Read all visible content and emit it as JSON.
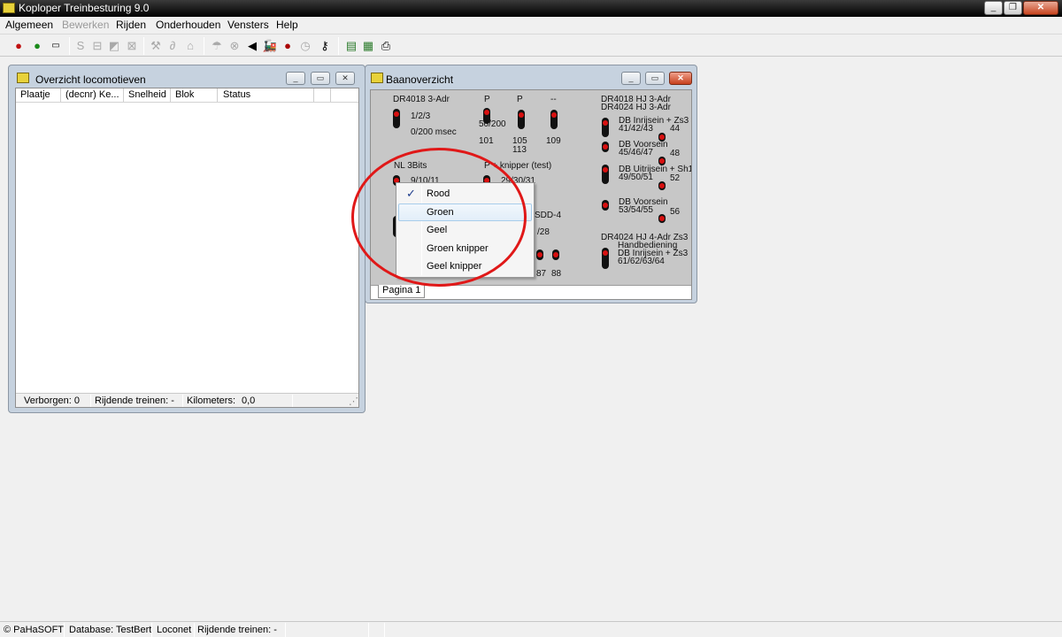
{
  "app": {
    "title": "Koploper Treinbesturing 9.0"
  },
  "menu": [
    "Algemeen",
    "Bewerken",
    "Rijden",
    "Onderhouden",
    "Vensters",
    "Help"
  ],
  "toolbar_icons": [
    "signal-red-icon",
    "signal-green-icon",
    "keyboard-icon",
    "s-icon",
    "block-icon",
    "route-icon",
    "delete-icon",
    "switch-icon",
    "lamp-icon",
    "horn-icon",
    "sound-icon",
    "locomotive-icon",
    "red-dot-icon",
    "clock-icon",
    "key-icon",
    "document-icon",
    "page-copy-icon",
    "printer-icon"
  ],
  "loco_window": {
    "title": "Overzicht locomotieven",
    "columns": [
      "Plaatje",
      "(decnr) Ke...",
      "Snelheid",
      "Blok",
      "Status"
    ],
    "status": {
      "hidden": "Verborgen: 0",
      "driving": "Rijdende treinen: -",
      "km_label": "Kilometers:",
      "km_value": "0,0"
    }
  },
  "track_window": {
    "title": "Baanoverzicht",
    "tab": "Pagina 1",
    "labels": {
      "dr4018": "DR4018 3-Adr",
      "addr123": "1/2/3",
      "msec": "0/200 msec",
      "p1": "P",
      "p1val": "50/200",
      "n101": "101",
      "p2": "P",
      "n105": "105",
      "n113": "113",
      "dash": "--",
      "n109": "109",
      "nl3bits": "NL 3Bits",
      "knipper": "P + knipper (test)",
      "addr9": "9/10/11",
      "addr29": "29/30/31",
      "sdd4": "SDD-4",
      "addr28": "/28",
      "n87": "87",
      "n88": "88",
      "hj3a": "DR4018 HJ 3-Adr",
      "hj3b": "DR4024 HJ 3-Adr",
      "inrijsein": "DB Inrijsein + Zs3",
      "addr41": "41/42/43",
      "n44": "44",
      "voorsein1": "DB Voorsein",
      "addr45": "45/46/47",
      "n48": "48",
      "uitrijsein": "DB Uitrijsein + Sh1",
      "addr49": "49/50/51",
      "n52": "52",
      "voorsein2": "DB Voorsein",
      "addr53": "53/54/55",
      "n56": "56",
      "hj4": "DR4024 HJ 4-Adr Zs3",
      "hand": "Handbediening",
      "inrijsein2": "DB Inrijsein + Zs3",
      "addr61": "61/62/63/64"
    }
  },
  "context_menu": {
    "checked": "✓",
    "items": [
      "Rood",
      "Groen",
      "Geel",
      "Groen knipper",
      "Geel knipper"
    ]
  },
  "statusbar": {
    "copyright": "© PaHaSOFT",
    "database": "Database: TestBert",
    "interface": "Loconet",
    "driving": "Rijdende treinen: -"
  }
}
